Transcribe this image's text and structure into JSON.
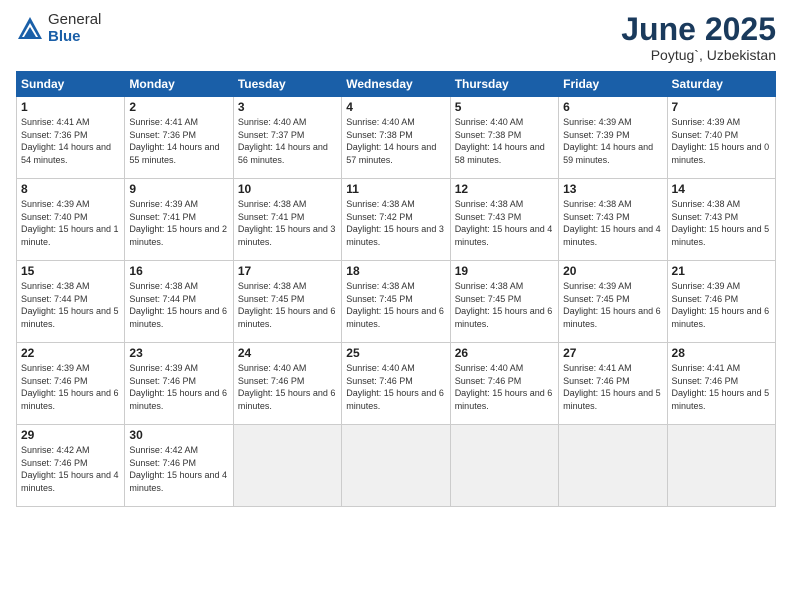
{
  "header": {
    "logo_general": "General",
    "logo_blue": "Blue",
    "title": "June 2025",
    "location": "Poytug`, Uzbekistan"
  },
  "days_of_week": [
    "Sunday",
    "Monday",
    "Tuesday",
    "Wednesday",
    "Thursday",
    "Friday",
    "Saturday"
  ],
  "weeks": [
    [
      {
        "day": 1,
        "sunrise": "4:41 AM",
        "sunset": "7:36 PM",
        "daylight": "14 hours and 54 minutes."
      },
      {
        "day": 2,
        "sunrise": "4:41 AM",
        "sunset": "7:36 PM",
        "daylight": "14 hours and 55 minutes."
      },
      {
        "day": 3,
        "sunrise": "4:40 AM",
        "sunset": "7:37 PM",
        "daylight": "14 hours and 56 minutes."
      },
      {
        "day": 4,
        "sunrise": "4:40 AM",
        "sunset": "7:38 PM",
        "daylight": "14 hours and 57 minutes."
      },
      {
        "day": 5,
        "sunrise": "4:40 AM",
        "sunset": "7:38 PM",
        "daylight": "14 hours and 58 minutes."
      },
      {
        "day": 6,
        "sunrise": "4:39 AM",
        "sunset": "7:39 PM",
        "daylight": "14 hours and 59 minutes."
      },
      {
        "day": 7,
        "sunrise": "4:39 AM",
        "sunset": "7:40 PM",
        "daylight": "15 hours and 0 minutes."
      }
    ],
    [
      {
        "day": 8,
        "sunrise": "4:39 AM",
        "sunset": "7:40 PM",
        "daylight": "15 hours and 1 minute."
      },
      {
        "day": 9,
        "sunrise": "4:39 AM",
        "sunset": "7:41 PM",
        "daylight": "15 hours and 2 minutes."
      },
      {
        "day": 10,
        "sunrise": "4:38 AM",
        "sunset": "7:41 PM",
        "daylight": "15 hours and 3 minutes."
      },
      {
        "day": 11,
        "sunrise": "4:38 AM",
        "sunset": "7:42 PM",
        "daylight": "15 hours and 3 minutes."
      },
      {
        "day": 12,
        "sunrise": "4:38 AM",
        "sunset": "7:43 PM",
        "daylight": "15 hours and 4 minutes."
      },
      {
        "day": 13,
        "sunrise": "4:38 AM",
        "sunset": "7:43 PM",
        "daylight": "15 hours and 4 minutes."
      },
      {
        "day": 14,
        "sunrise": "4:38 AM",
        "sunset": "7:43 PM",
        "daylight": "15 hours and 5 minutes."
      }
    ],
    [
      {
        "day": 15,
        "sunrise": "4:38 AM",
        "sunset": "7:44 PM",
        "daylight": "15 hours and 5 minutes."
      },
      {
        "day": 16,
        "sunrise": "4:38 AM",
        "sunset": "7:44 PM",
        "daylight": "15 hours and 6 minutes."
      },
      {
        "day": 17,
        "sunrise": "4:38 AM",
        "sunset": "7:45 PM",
        "daylight": "15 hours and 6 minutes."
      },
      {
        "day": 18,
        "sunrise": "4:38 AM",
        "sunset": "7:45 PM",
        "daylight": "15 hours and 6 minutes."
      },
      {
        "day": 19,
        "sunrise": "4:38 AM",
        "sunset": "7:45 PM",
        "daylight": "15 hours and 6 minutes."
      },
      {
        "day": 20,
        "sunrise": "4:39 AM",
        "sunset": "7:45 PM",
        "daylight": "15 hours and 6 minutes."
      },
      {
        "day": 21,
        "sunrise": "4:39 AM",
        "sunset": "7:46 PM",
        "daylight": "15 hours and 6 minutes."
      }
    ],
    [
      {
        "day": 22,
        "sunrise": "4:39 AM",
        "sunset": "7:46 PM",
        "daylight": "15 hours and 6 minutes."
      },
      {
        "day": 23,
        "sunrise": "4:39 AM",
        "sunset": "7:46 PM",
        "daylight": "15 hours and 6 minutes."
      },
      {
        "day": 24,
        "sunrise": "4:40 AM",
        "sunset": "7:46 PM",
        "daylight": "15 hours and 6 minutes."
      },
      {
        "day": 25,
        "sunrise": "4:40 AM",
        "sunset": "7:46 PM",
        "daylight": "15 hours and 6 minutes."
      },
      {
        "day": 26,
        "sunrise": "4:40 AM",
        "sunset": "7:46 PM",
        "daylight": "15 hours and 6 minutes."
      },
      {
        "day": 27,
        "sunrise": "4:41 AM",
        "sunset": "7:46 PM",
        "daylight": "15 hours and 5 minutes."
      },
      {
        "day": 28,
        "sunrise": "4:41 AM",
        "sunset": "7:46 PM",
        "daylight": "15 hours and 5 minutes."
      }
    ],
    [
      {
        "day": 29,
        "sunrise": "4:42 AM",
        "sunset": "7:46 PM",
        "daylight": "15 hours and 4 minutes."
      },
      {
        "day": 30,
        "sunrise": "4:42 AM",
        "sunset": "7:46 PM",
        "daylight": "15 hours and 4 minutes."
      },
      null,
      null,
      null,
      null,
      null
    ]
  ]
}
